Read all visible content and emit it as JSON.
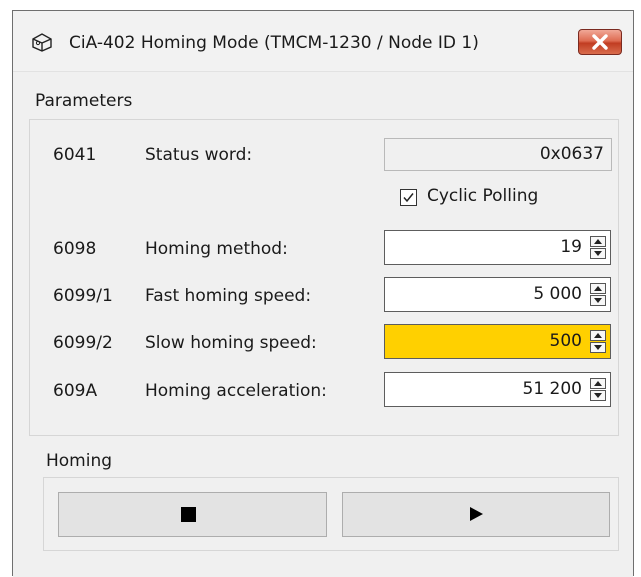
{
  "window": {
    "title": "CiA-402 Homing Mode (TMCM-1230 / Node ID 1)",
    "close_icon": "close-x-icon",
    "app_icon": "box-icon",
    "close_color": "#d0523a"
  },
  "parameters": {
    "section_label": "Parameters",
    "status_word": {
      "index": "6041",
      "label": "Status word:",
      "value": "0x0637"
    },
    "cyclic_polling": {
      "label": "Cyclic Polling",
      "checked": true
    },
    "homing_method": {
      "index": "6098",
      "label": "Homing method:",
      "value": "19"
    },
    "fast_speed": {
      "index": "6099/1",
      "label": "Fast homing speed:",
      "value": "5 000"
    },
    "slow_speed": {
      "index": "6099/2",
      "label": "Slow homing speed:",
      "value": "500",
      "highlight_color": "#ffd000"
    },
    "acceleration": {
      "index": "609A",
      "label": "Homing acceleration:",
      "value": "51 200"
    }
  },
  "homing": {
    "section_label": "Homing",
    "stop_icon": "stop-icon",
    "start_icon": "play-icon"
  }
}
